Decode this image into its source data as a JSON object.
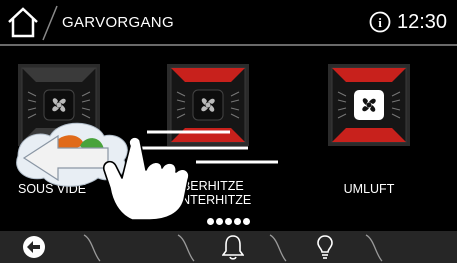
{
  "header": {
    "title": "GARVORGANG",
    "clock": "12:30",
    "home_icon": "home-icon",
    "info_icon": "info-icon"
  },
  "modes": [
    {
      "label": "SOUS VIDE",
      "icon": "fan-icon",
      "heating": "none",
      "selected": false
    },
    {
      "label_line1": "OBERHITZE",
      "label_line2": "+UNTERHITZE",
      "icon": "fan-icon",
      "heating": "top-bottom",
      "selected": true
    },
    {
      "label": "UMLUFT",
      "icon": "fan-icon",
      "heating": "top-bottom",
      "selected": false
    }
  ],
  "pager": {
    "pages": 5,
    "current": 1
  },
  "footer": {
    "back_icon": "back-arrow-icon",
    "timer_icon": "bell-icon",
    "hint_icon": "lightbulb-icon"
  },
  "overlay": {
    "gesture": "swipe-left-hand-icon"
  },
  "colors": {
    "heat_red": "#c8211c",
    "tile_bg": "#1a1a1a",
    "bar_bg": "#262626"
  }
}
